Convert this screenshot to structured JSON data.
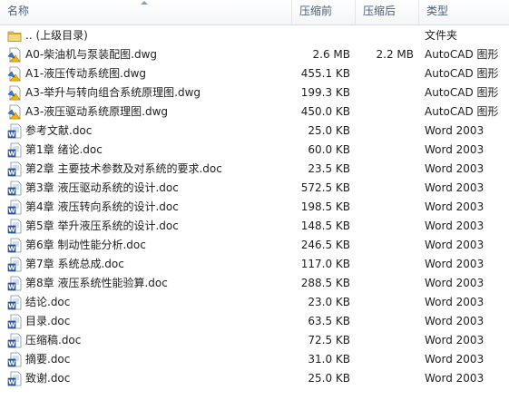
{
  "header": {
    "name": "名称",
    "compressed": "压缩前",
    "original": "压缩后",
    "type": "类型"
  },
  "rows": [
    {
      "icon": "folder-icon",
      "name": ".. (上级目录)",
      "compressed": "",
      "original": "",
      "type": "文件夹"
    },
    {
      "icon": "dwg-file-icon",
      "name": "A0-柴油机与泵装配图.dwg",
      "compressed": "2.6 MB",
      "original": "2.2 MB",
      "type": "AutoCAD 图形"
    },
    {
      "icon": "dwg-file-icon",
      "name": "A1-液压传动系统图.dwg",
      "compressed": "455.1 KB",
      "original": "",
      "type": "AutoCAD 图形"
    },
    {
      "icon": "dwg-file-icon",
      "name": "A3-举升与转向组合系统原理图.dwg",
      "compressed": "199.3 KB",
      "original": "",
      "type": "AutoCAD 图形"
    },
    {
      "icon": "dwg-file-icon",
      "name": "A3-液压驱动系统原理图.dwg",
      "compressed": "450.0 KB",
      "original": "",
      "type": "AutoCAD 图形"
    },
    {
      "icon": "word-doc-icon",
      "name": "参考文献.doc",
      "compressed": "25.0 KB",
      "original": "",
      "type": "Word 2003"
    },
    {
      "icon": "word-doc-icon",
      "name": "第1章 绪论.doc",
      "compressed": "60.0 KB",
      "original": "",
      "type": "Word 2003"
    },
    {
      "icon": "word-doc-icon",
      "name": "第2章 主要技术参数及对系统的要求.doc",
      "compressed": "23.5 KB",
      "original": "",
      "type": "Word 2003"
    },
    {
      "icon": "word-doc-icon",
      "name": "第3章 液压驱动系统的设计.doc",
      "compressed": "572.5 KB",
      "original": "",
      "type": "Word 2003"
    },
    {
      "icon": "word-doc-icon",
      "name": "第4章 液压转向系统的设计.doc",
      "compressed": "198.5 KB",
      "original": "",
      "type": "Word 2003"
    },
    {
      "icon": "word-doc-icon",
      "name": "第5章 举升液压系统的设计.doc",
      "compressed": "148.5 KB",
      "original": "",
      "type": "Word 2003"
    },
    {
      "icon": "word-doc-icon",
      "name": "第6章 制动性能分析.doc",
      "compressed": "246.5 KB",
      "original": "",
      "type": "Word 2003"
    },
    {
      "icon": "word-doc-icon",
      "name": "第7章 系统总成.doc",
      "compressed": "117.0 KB",
      "original": "",
      "type": "Word 2003"
    },
    {
      "icon": "word-doc-icon",
      "name": "第8章 液压系统性能验算.doc",
      "compressed": "288.5 KB",
      "original": "",
      "type": "Word 2003"
    },
    {
      "icon": "word-doc-icon",
      "name": "结论.doc",
      "compressed": "23.0 KB",
      "original": "",
      "type": "Word 2003"
    },
    {
      "icon": "word-doc-icon",
      "name": "目录.doc",
      "compressed": "63.5 KB",
      "original": "",
      "type": "Word 2003"
    },
    {
      "icon": "word-doc-icon",
      "name": "压缩稿.doc",
      "compressed": "72.5 KB",
      "original": "",
      "type": "Word 2003"
    },
    {
      "icon": "word-doc-icon",
      "name": "摘要.doc",
      "compressed": "31.0 KB",
      "original": "",
      "type": "Word 2003"
    },
    {
      "icon": "word-doc-icon",
      "name": "致谢.doc",
      "compressed": "25.0 KB",
      "original": "",
      "type": "Word 2003"
    }
  ]
}
